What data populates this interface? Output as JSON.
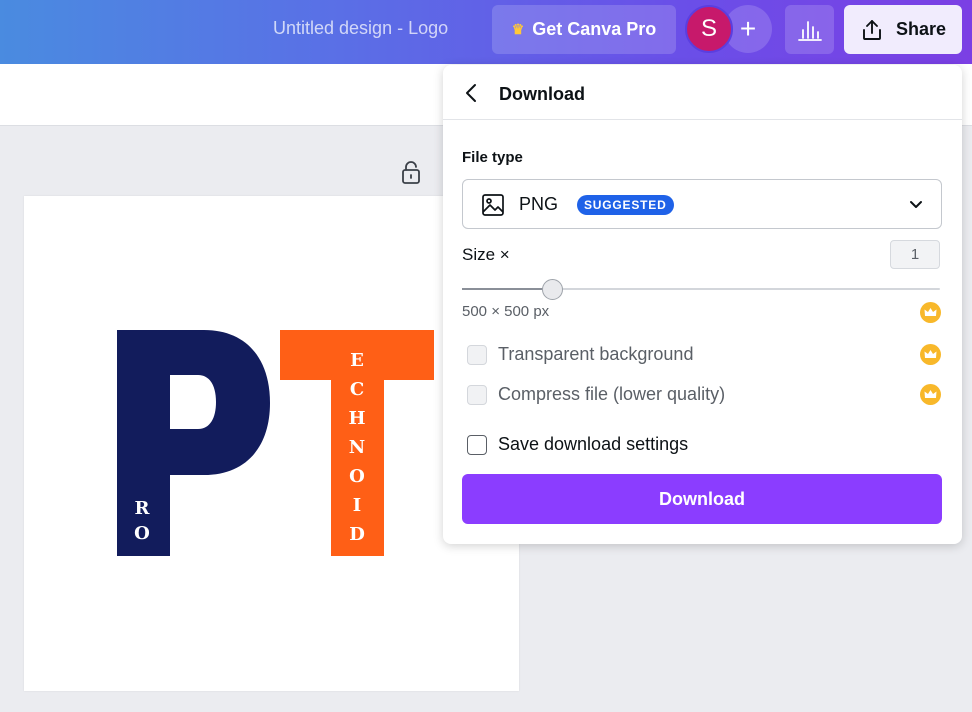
{
  "header": {
    "doc_title": "Untitled design - Logo",
    "pro_label": "Get Canva Pro",
    "avatar_initial": "S",
    "add_label": "+",
    "share_label": "Share"
  },
  "canvas": {
    "logo_letters_ro": [
      "R",
      "O"
    ],
    "logo_letters_echnoid": [
      "E",
      "C",
      "H",
      "N",
      "O",
      "I",
      "D"
    ],
    "colors": {
      "navy": "#121c5c",
      "orange": "#ff5f16"
    }
  },
  "download_panel": {
    "title": "Download",
    "file_type_label": "File type",
    "file_type_value": "PNG",
    "suggested_badge": "SUGGESTED",
    "size_label": "Size ×",
    "size_value": "1",
    "dimensions": "500 × 500 px",
    "options": [
      {
        "label": "Transparent background",
        "checked": false,
        "disabled": true,
        "pro": true
      },
      {
        "label": "Compress file (lower quality)",
        "checked": false,
        "disabled": true,
        "pro": true
      },
      {
        "label": "Save download settings",
        "checked": false,
        "disabled": false,
        "pro": false
      }
    ],
    "download_label": "Download",
    "accent_color": "#8b3dff"
  }
}
